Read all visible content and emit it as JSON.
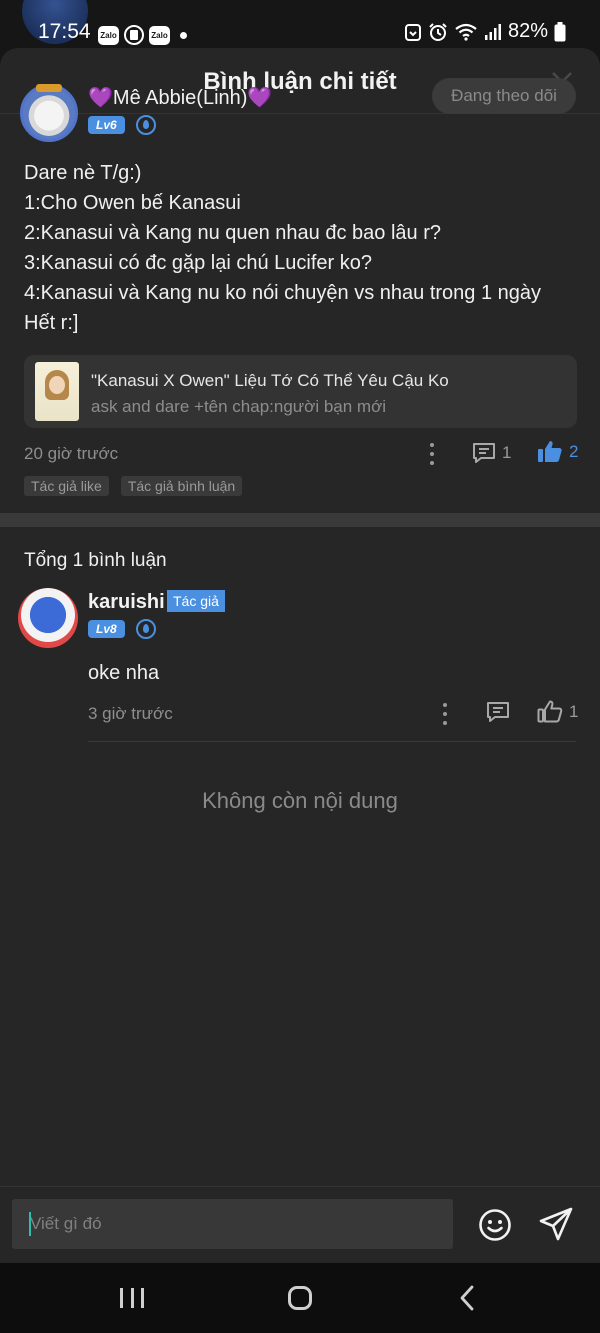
{
  "status_bar": {
    "time": "17:54",
    "notif_icons": [
      "Zalo",
      "Zalo"
    ],
    "battery": "82%"
  },
  "header": {
    "title": "Bình luận chi tiết"
  },
  "comment": {
    "author": "💜Mê Abbie(Linh)💜",
    "level": "Lv6",
    "follow_label": "Đang theo dõi",
    "lines": [
      "Dare nè T/g:)",
      "1:Cho Owen bế Kanasui",
      "2:Kanasui và Kang nu quen nhau đc bao lâu r?",
      "3:Kanasui có đc gặp lại chú Lucifer ko?",
      "4:Kanasui và Kang nu ko nói chuyện vs nhau trong 1 ngày",
      "Hết r:]"
    ],
    "story": {
      "title": "\"Kanasui X Owen\" Liệu Tớ Có Thể Yêu Cậu Ko",
      "subtitle": "ask and dare +tên chap:người bạn mới"
    },
    "time": "20 giờ trước",
    "reply_count": "1",
    "like_count": "2",
    "tags": [
      "Tác giả like",
      "Tác giả bình luận"
    ]
  },
  "replies": {
    "total_label": "Tổng 1 bình luận",
    "items": [
      {
        "author": "karuishi",
        "author_tag": "Tác giả",
        "level": "Lv8",
        "text": "oke nha",
        "time": "3 giờ trước",
        "like_count": "1"
      }
    ],
    "end_label": "Không còn nội dung"
  },
  "input": {
    "placeholder": "Viết gì đó"
  },
  "colors": {
    "accent": "#4a8fe0",
    "background": "#262626"
  }
}
